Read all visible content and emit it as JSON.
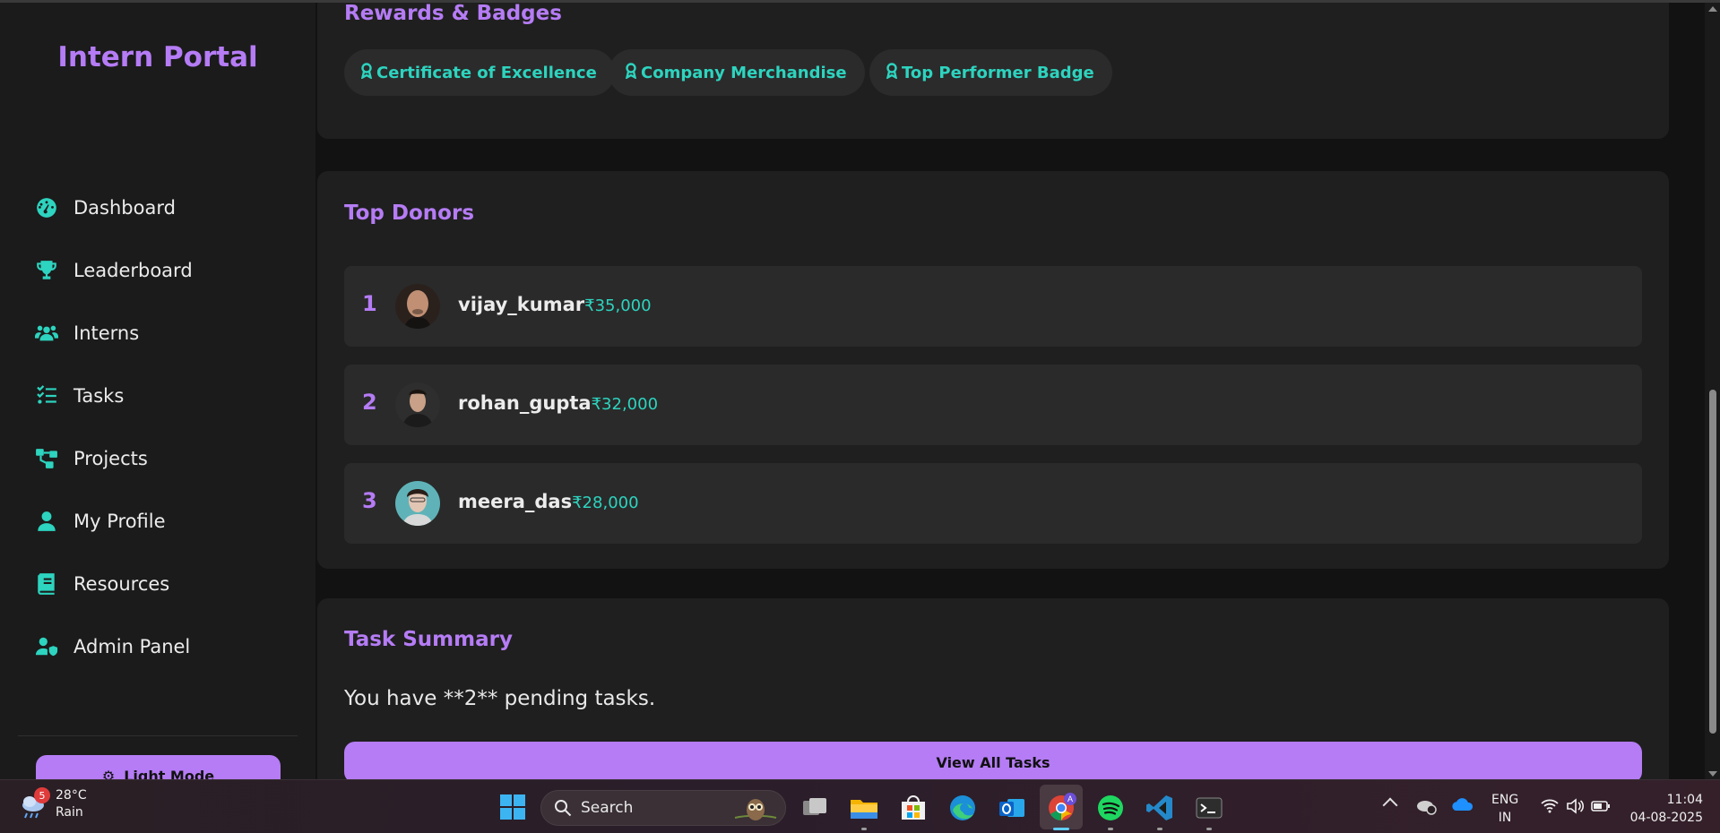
{
  "app": {
    "brand": "Intern Portal"
  },
  "sidebar": {
    "items": [
      {
        "label": "Dashboard",
        "icon": "gauge-icon"
      },
      {
        "label": "Leaderboard",
        "icon": "trophy-icon"
      },
      {
        "label": "Interns",
        "icon": "users-icon"
      },
      {
        "label": "Tasks",
        "icon": "list-check-icon"
      },
      {
        "label": "Projects",
        "icon": "diagram-icon"
      },
      {
        "label": "My Profile",
        "icon": "user-icon"
      },
      {
        "label": "Resources",
        "icon": "book-icon"
      },
      {
        "label": "Admin Panel",
        "icon": "user-shield-icon"
      }
    ],
    "mode_button": "Light Mode"
  },
  "rewards": {
    "title": "Rewards & Badges",
    "badges": [
      "Certificate of Excellence",
      "Company Merchandise",
      "Top Performer Badge"
    ]
  },
  "donors": {
    "title": "Top Donors",
    "list": [
      {
        "rank": "1",
        "name": "vijay_kumar",
        "amount": "₹35,000"
      },
      {
        "rank": "2",
        "name": "rohan_gupta",
        "amount": "₹32,000"
      },
      {
        "rank": "3",
        "name": "meera_das",
        "amount": "₹28,000"
      }
    ]
  },
  "task_summary": {
    "title": "Task Summary",
    "text": "You have **2** pending tasks.",
    "button": "View All Tasks"
  },
  "taskbar": {
    "weather_temp": "28°C",
    "weather_desc": "Rain",
    "weather_badge": "5",
    "search_placeholder": "Search",
    "lang_1": "ENG",
    "lang_2": "IN",
    "time": "11:04",
    "date": "04-08-2025",
    "chrome_badge": "A"
  },
  "colors": {
    "accent_purple": "#b57cf5",
    "accent_teal": "#2dd4bf",
    "sidebar_bg": "#1b1b1b",
    "card_bg": "#1f1f1f"
  }
}
